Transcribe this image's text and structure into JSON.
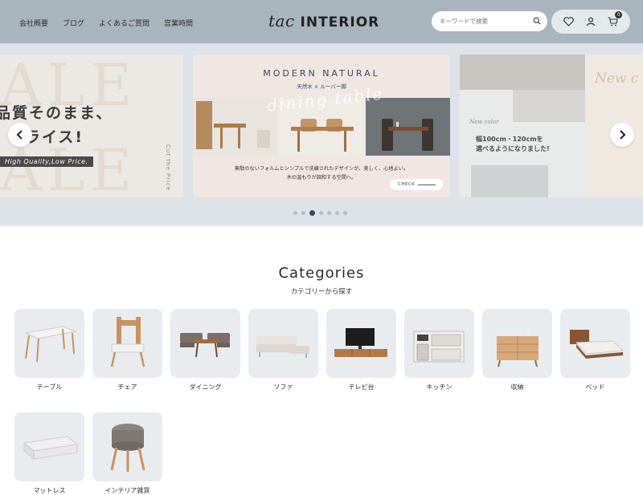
{
  "header": {
    "nav": [
      "会社概要",
      "ブログ",
      "よくあるご質問",
      "営業時間"
    ],
    "logo_script": "tac",
    "logo_word": "INTERIOR",
    "search_placeholder": "キーワードで検索",
    "cart_count": "0",
    "icons": [
      "search-icon",
      "heart-icon",
      "user-icon",
      "cart-icon"
    ]
  },
  "slider": {
    "left": {
      "bg_word_top": "ALE",
      "bg_word_bottom": "ALE",
      "headline_1": "品質そのまま、",
      "headline_2": "プライス!",
      "tagline": "High Quality,Low Price.",
      "vertical": "Cut the Price"
    },
    "main": {
      "title": "MODERN NATURAL",
      "subtitle": "天然木 × ルーバー脚",
      "script": "dining table",
      "desc_1": "無駄のないフォルムとシンプルで洗練されたデザインが、美しく、心地よい。",
      "desc_2": "木の温もりが調和する空間へ。",
      "cta": "CHECK"
    },
    "right": {
      "badge": "New color",
      "script": "New c",
      "text_1": "幅100cm・120cmを",
      "text_2": "選べるようになりました!"
    },
    "dots": 7,
    "active_dot": 3,
    "prev_icon": "chevron-left-icon",
    "next_icon": "chevron-right-icon"
  },
  "categories": {
    "title": "Categories",
    "subtitle": "カテゴリーから探す",
    "items": [
      {
        "label": "テーブル",
        "icon": "table-image"
      },
      {
        "label": "チェア",
        "icon": "chair-image"
      },
      {
        "label": "ダイニング",
        "icon": "dining-set-image"
      },
      {
        "label": "ソファ",
        "icon": "sofa-image"
      },
      {
        "label": "テレビ台",
        "icon": "tv-stand-image"
      },
      {
        "label": "キッチン",
        "icon": "kitchen-cabinet-image"
      },
      {
        "label": "収納",
        "icon": "storage-chest-image"
      },
      {
        "label": "ベッド",
        "icon": "bed-image"
      },
      {
        "label": "マットレス",
        "icon": "mattress-image"
      },
      {
        "label": "インテリア雑貨",
        "icon": "stool-image"
      }
    ]
  },
  "colors": {
    "header_bg": "#a9b5bd",
    "slider_bg": "#dde3e8",
    "card_bg": "#e8ecef",
    "accent_dark": "#3b4a57"
  }
}
